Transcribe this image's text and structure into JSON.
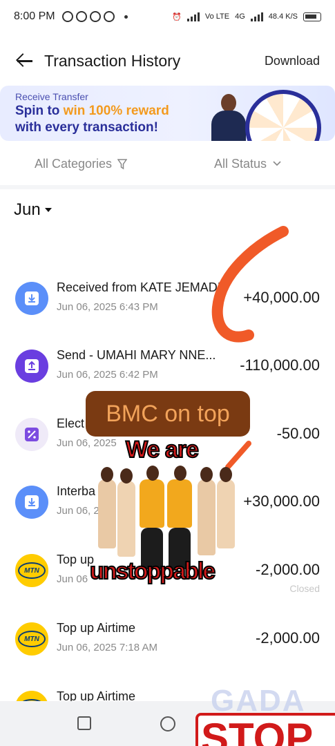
{
  "status_bar": {
    "time": "8:00 PM",
    "network_left": "Vo LTE",
    "network_right": "4G",
    "speed": "48.4 K/S",
    "battery": "65"
  },
  "header": {
    "title": "Transaction History",
    "download": "Download"
  },
  "banner": {
    "subtitle": "Receive Transfer",
    "line1_prefix": "Spin to",
    "line1_highlight": "win 100% reward",
    "line2": "with every transaction!"
  },
  "filters": {
    "categories": "All Categories",
    "status": "All Status"
  },
  "month": "Jun",
  "transactions": [
    {
      "title": "Received from KATE JEMADI",
      "date": "Jun 06, 2025 6:43 PM",
      "amount": "+40,000.00",
      "status": "",
      "icon": "receive-icon"
    },
    {
      "title": "Send - UMAHI   MARY NNE...",
      "date": "Jun 06, 2025 6:42 PM",
      "amount": "-110,000.00",
      "status": "",
      "icon": "send-icon"
    },
    {
      "title": "Elect",
      "date": "Jun 06, 2025",
      "amount": "-50.00",
      "status": "",
      "icon": "percent-icon"
    },
    {
      "title": "Interba",
      "date": "Jun 06, 2",
      "amount": "+30,000.00",
      "status": "",
      "icon": "receive-icon"
    },
    {
      "title": "Top up",
      "date": "Jun 06",
      "amount": "-2,000.00",
      "status": "Closed",
      "icon": "mtn-logo"
    },
    {
      "title": "Top up Airtime",
      "date": "Jun 06, 2025 7:18 AM",
      "amount": "-2,000.00",
      "status": "",
      "icon": "mtn-logo"
    },
    {
      "title": "Top up Airtime",
      "date": "",
      "amount": "",
      "status": "",
      "icon": "mtn-logo"
    }
  ],
  "mtn_label": "MTN",
  "overlays": {
    "caption": "BMC on top",
    "sticker_top": "We are",
    "sticker_bottom": "unstoppable",
    "watermark": "GADA",
    "stop": "STOP"
  },
  "colors": {
    "accent_blue": "#5b8ff9",
    "accent_purple": "#6a3ee0",
    "banner_text": "#2a2f9a",
    "banner_highlight": "#f39a1e",
    "brush_orange": "#f05a28",
    "mtn_yellow": "#ffcc00"
  }
}
